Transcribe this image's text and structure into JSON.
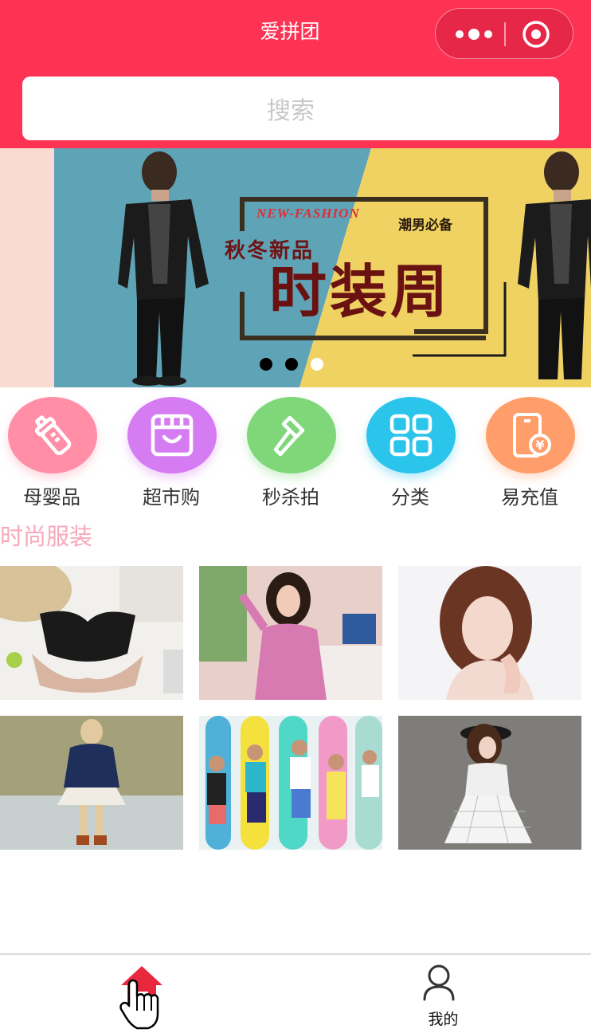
{
  "header": {
    "title": "爱拼团",
    "search_placeholder": "搜索",
    "bg_color": "#fe3353"
  },
  "banner": {
    "en_text": "NEW-FASHION",
    "tag_text": "潮男必备",
    "sub_text": "秋冬新品",
    "main_text": "时装周",
    "indicators": [
      "inactive",
      "inactive",
      "active"
    ]
  },
  "categories": [
    {
      "label": "母婴品",
      "icon": "baby-bottle-icon",
      "color": "#ff8ea6"
    },
    {
      "label": "超市购",
      "icon": "shop-icon",
      "color": "#d57cf2"
    },
    {
      "label": "秒杀拍",
      "icon": "auction-hammer-icon",
      "color": "#7fd77a"
    },
    {
      "label": "分类",
      "icon": "grid-icon",
      "color": "#2bc4ea"
    },
    {
      "label": "易充值",
      "icon": "phone-recharge-icon",
      "color": "#ff9e6a"
    }
  ],
  "section": {
    "title": "时尚服装"
  },
  "products": [
    {
      "image": "bra-product-photo"
    },
    {
      "image": "pink-top-model-photo"
    },
    {
      "image": "woman-portrait-photo"
    },
    {
      "image": "runway-model-photo"
    },
    {
      "image": "surfboard-group-photo"
    },
    {
      "image": "white-dress-model-photo"
    }
  ],
  "tabbar": {
    "items": [
      {
        "label": "",
        "icon": "home-icon",
        "active": true,
        "color": "#e8283f"
      },
      {
        "label": "我的",
        "icon": "user-icon",
        "active": false,
        "color": "#333333"
      }
    ]
  }
}
